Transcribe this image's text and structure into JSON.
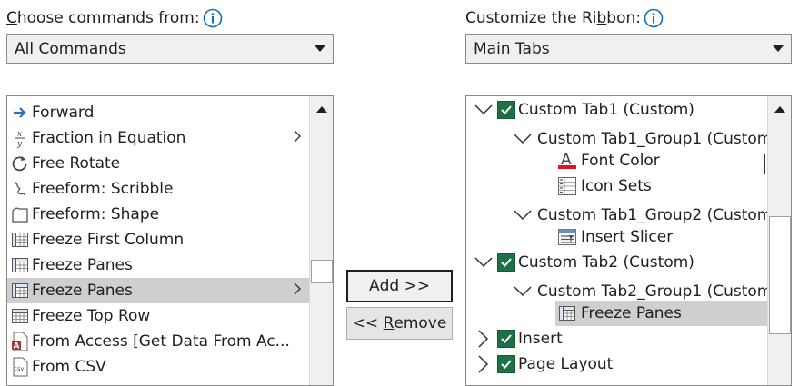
{
  "left": {
    "label_prefix": "",
    "label_access": "C",
    "label_rest": "hoose commands from:",
    "combo_value": "All Commands",
    "items": [
      {
        "label": "Forward",
        "icon": "arrow-right-icon",
        "submenu": false,
        "selected": false
      },
      {
        "label": "Fraction in Equation",
        "icon": "fraction-icon",
        "submenu": true,
        "selected": false
      },
      {
        "label": "Free Rotate",
        "icon": "rotate-icon",
        "submenu": false,
        "selected": false
      },
      {
        "label": "Freeform: Scribble",
        "icon": "scribble-icon",
        "submenu": false,
        "selected": false
      },
      {
        "label": "Freeform: Shape",
        "icon": "freeform-shape-icon",
        "submenu": false,
        "selected": false
      },
      {
        "label": "Freeze First Column",
        "icon": "freeze-first-column-icon",
        "submenu": false,
        "selected": false
      },
      {
        "label": "Freeze Panes",
        "icon": "freeze-panes-icon",
        "submenu": false,
        "selected": false
      },
      {
        "label": "Freeze Panes",
        "icon": "freeze-panes-icon",
        "submenu": true,
        "selected": true
      },
      {
        "label": "Freeze Top Row",
        "icon": "freeze-top-row-icon",
        "submenu": false,
        "selected": false
      },
      {
        "label": "From Access [Get Data From Ac...",
        "icon": "access-icon",
        "submenu": false,
        "selected": false
      },
      {
        "label": "From CSV",
        "icon": "csv-icon",
        "submenu": false,
        "selected": false
      }
    ]
  },
  "right": {
    "label_before": "Customize the Ri",
    "label_access": "b",
    "label_after": "bon:",
    "combo_value": "Main Tabs",
    "items": [
      {
        "label": "Custom Tab1 (Custom)",
        "level": 0,
        "expander": "expanded",
        "checked": true,
        "icon": "",
        "selected": false
      },
      {
        "label": "Custom Tab1_Group1 (Custom)",
        "level": 1,
        "expander": "expanded",
        "checked": false,
        "icon": "",
        "selected": false
      },
      {
        "label": "Font Color",
        "level": 2,
        "expander": "",
        "checked": false,
        "icon": "font-color-icon",
        "selected": false
      },
      {
        "label": "Icon Sets",
        "level": 2,
        "expander": "",
        "checked": false,
        "icon": "icon-sets-icon",
        "selected": false
      },
      {
        "label": "Custom Tab1_Group2 (Custom)",
        "level": 1,
        "expander": "expanded",
        "checked": false,
        "icon": "",
        "selected": false
      },
      {
        "label": "Insert Slicer",
        "level": 2,
        "expander": "",
        "checked": false,
        "icon": "slicer-icon",
        "selected": false
      },
      {
        "label": "Custom Tab2 (Custom)",
        "level": 0,
        "expander": "expanded",
        "checked": true,
        "icon": "",
        "selected": false
      },
      {
        "label": "Custom Tab2_Group1 (Custom)",
        "level": 1,
        "expander": "expanded",
        "checked": false,
        "icon": "",
        "selected": false
      },
      {
        "label": "Freeze Panes",
        "level": 2,
        "expander": "",
        "checked": false,
        "icon": "freeze-panes-icon",
        "selected": true
      },
      {
        "label": "Insert",
        "level": 0,
        "expander": "collapsed",
        "checked": true,
        "icon": "",
        "selected": false
      },
      {
        "label": "Page Layout",
        "level": 0,
        "expander": "collapsed",
        "checked": true,
        "icon": "",
        "selected": false
      }
    ]
  },
  "buttons": {
    "add_access": "A",
    "add_rest": "dd >>",
    "remove_prefix": "<< ",
    "remove_access": "R",
    "remove_rest": "emove"
  },
  "colors": {
    "check_green": "#1e7145",
    "selection": "#cfcfcf",
    "info_blue": "#0f6cbd",
    "font_color_red": "#e81123"
  }
}
